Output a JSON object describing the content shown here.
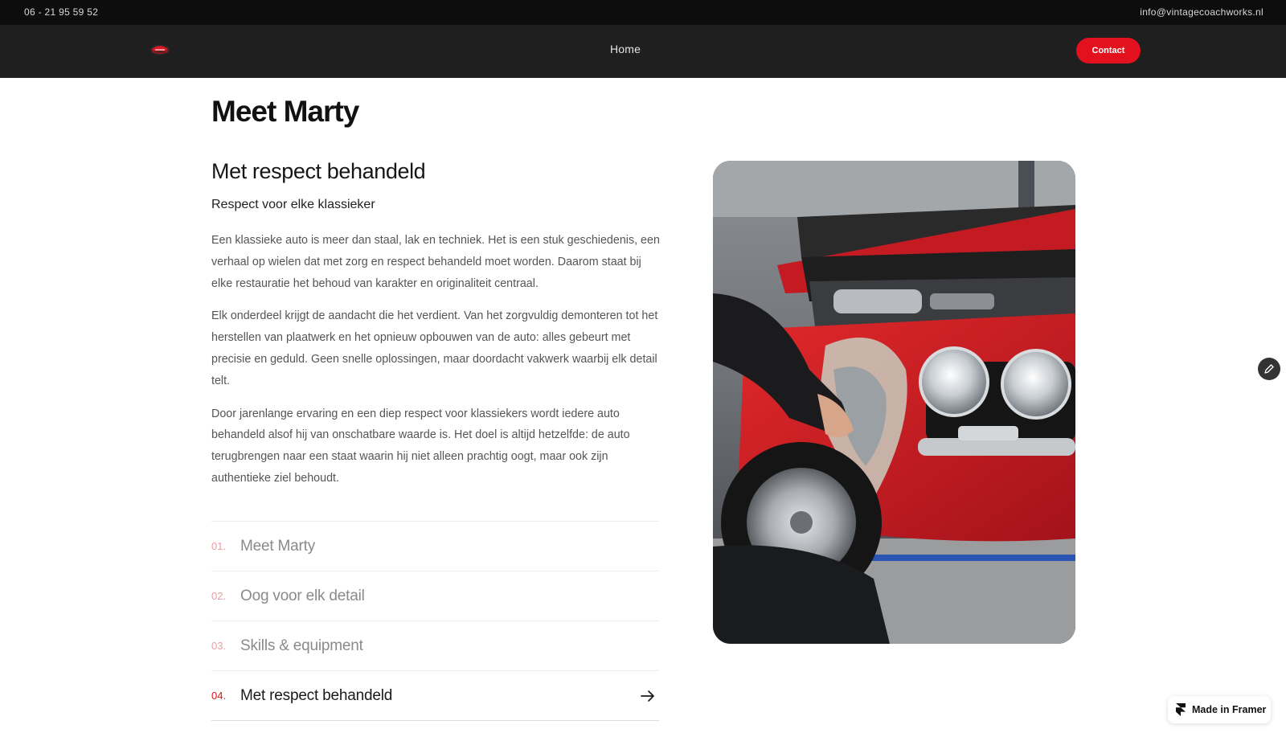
{
  "topbar": {
    "phone": "06 - 21 95 59 52",
    "email": "info@vintagecoachworks.nl"
  },
  "navbar": {
    "logo_icon": "vintage-car-badge-icon",
    "home_label": "Home",
    "contact_label": "Contact",
    "accent_color": "#e3111d"
  },
  "main": {
    "page_title": "Meet Marty",
    "section_title": "Met respect behandeld",
    "section_subtitle": "Respect voor elke klassieker",
    "paragraphs": [
      "Een klassieke auto is meer dan staal, lak en techniek. Het is een stuk geschiedenis, een verhaal op wielen dat met zorg en respect behandeld moet worden. Daarom staat bij elke restauratie het behoud van karakter en originaliteit centraal.",
      "Elk onderdeel krijgt de aandacht die het verdient. Van het zorgvuldig demonteren tot het herstellen van plaatwerk en het opnieuw opbouwen van de auto: alles gebeurt met precisie en geduld. Geen snelle oplossingen, maar doordacht vakwerk waarbij elk detail telt.",
      "Door jarenlange ervaring en een diep respect voor klassiekers wordt iedere auto behandeld alsof hij van onschatbare waarde is. Het doel is altijd hetzelfde: de auto terugbrengen naar een staat waarin hij niet alleen prachtig oogt, maar ook zijn authentieke ziel behoudt."
    ],
    "tabs": [
      {
        "number": "01.",
        "label": "Meet Marty",
        "active": false
      },
      {
        "number": "02.",
        "label": "Oog voor elk detail",
        "active": false
      },
      {
        "number": "03.",
        "label": "Skills & equipment",
        "active": false
      },
      {
        "number": "04.",
        "label": "Met respect behandeld",
        "active": true
      }
    ],
    "active_arrow_icon": "arrow-right-icon"
  },
  "photo": {
    "subject": "red-classic-car-restoration-photo"
  },
  "side": {
    "edit_icon": "pencil-icon"
  },
  "framer": {
    "label": "Made in Framer",
    "icon": "framer-logo-icon"
  }
}
